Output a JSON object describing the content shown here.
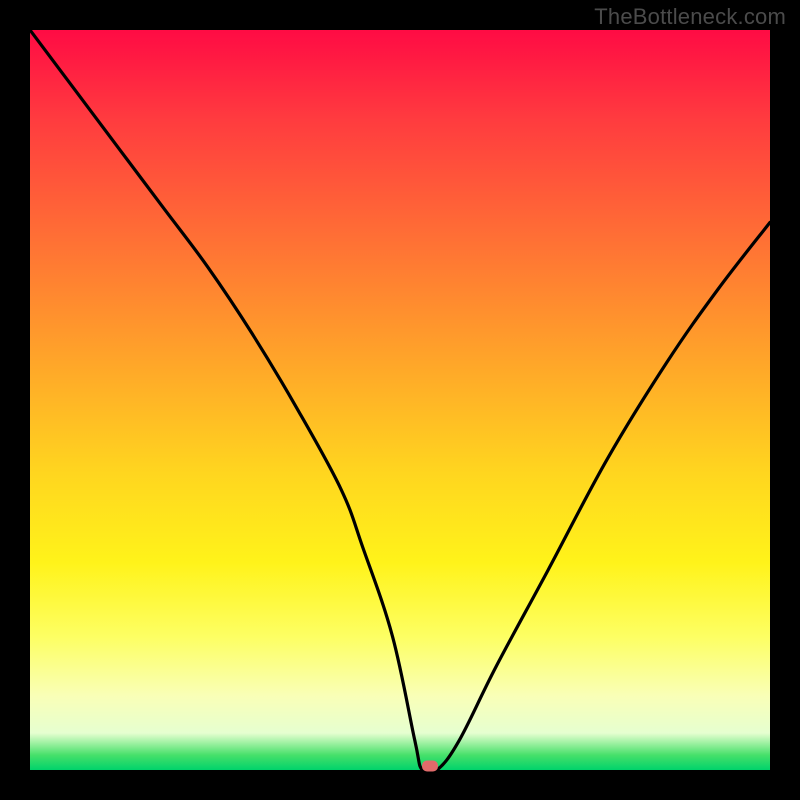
{
  "watermark": "TheBottleneck.com",
  "chart_data": {
    "type": "line",
    "title": "",
    "xlabel": "",
    "ylabel": "",
    "xlim": [
      0,
      100
    ],
    "ylim": [
      0,
      100
    ],
    "grid": false,
    "legend": null,
    "annotations": [],
    "series": [
      {
        "name": "bottleneck-curve",
        "x": [
          0,
          6,
          12,
          18,
          24,
          30,
          36,
          42,
          45,
          49,
          52,
          53,
          55,
          58,
          63,
          70,
          78,
          86,
          93,
          100
        ],
        "values": [
          100,
          92,
          84,
          76,
          68,
          59,
          49,
          38,
          30,
          18,
          4,
          0,
          0,
          4,
          14,
          27,
          42,
          55,
          65,
          74
        ],
        "color": "#000000"
      }
    ],
    "marker": {
      "x": 54,
      "y": 0,
      "color": "#e06a6a"
    }
  },
  "colors": {
    "frame": "#000000",
    "watermark": "#4b4b4b",
    "gradient_top": "#ff0b44",
    "gradient_bottom": "#00d36b"
  }
}
